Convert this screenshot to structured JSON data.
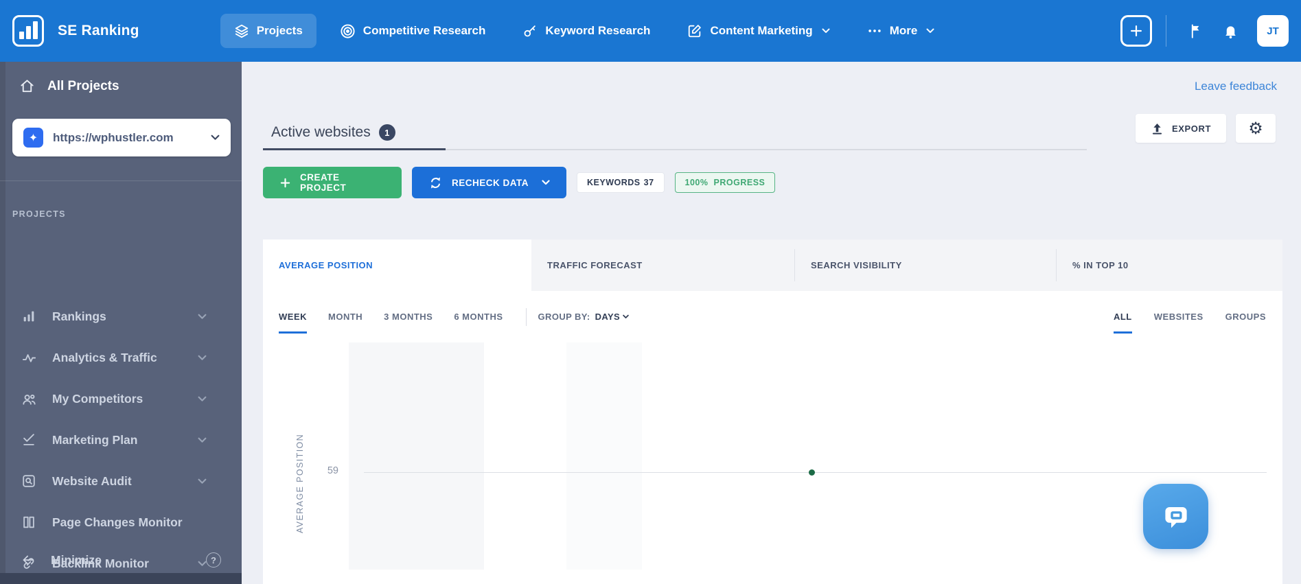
{
  "nav": {
    "brand": "SE Ranking",
    "items": [
      {
        "label": "Projects",
        "icon": "layers",
        "active": true
      },
      {
        "label": "Competitive Research",
        "icon": "target",
        "active": false
      },
      {
        "label": "Keyword Research",
        "icon": "key",
        "active": false
      },
      {
        "label": "Content Marketing",
        "icon": "edit-square",
        "has_dropdown": true,
        "active": false
      },
      {
        "label": "More",
        "icon": "ellipsis",
        "has_dropdown": true,
        "active": false
      }
    ],
    "user_initials": "JT"
  },
  "sidebar": {
    "all_projects_label": "All Projects",
    "project_url": "https://wphustler.com",
    "section_label": "PROJECTS",
    "items": [
      {
        "label": "Rankings",
        "icon": "bar-chart",
        "has_dropdown": true
      },
      {
        "label": "Analytics & Traffic",
        "icon": "pulse",
        "has_dropdown": true
      },
      {
        "label": "My Competitors",
        "icon": "users",
        "has_dropdown": true
      },
      {
        "label": "Marketing Plan",
        "icon": "check-list",
        "has_dropdown": true
      },
      {
        "label": "Website Audit",
        "icon": "search-square",
        "has_dropdown": true
      },
      {
        "label": "Page Changes Monitor",
        "icon": "pages",
        "has_dropdown": false
      },
      {
        "label": "Backlink Monitor",
        "icon": "link",
        "has_dropdown": true
      }
    ],
    "minimize_label": "Minimize"
  },
  "header": {
    "leave_feedback": "Leave feedback",
    "active_tab": "Active websites",
    "active_tab_count": "1",
    "export_label": "EXPORT"
  },
  "toolbar": {
    "create_project": "CREATE PROJECT",
    "recheck_data": "RECHECK DATA",
    "keywords_label": "KEYWORDS",
    "keywords_value": "37",
    "progress_value": "100%",
    "progress_label": "PROGRESS"
  },
  "metric_tabs": [
    {
      "label": "AVERAGE POSITION",
      "active": true
    },
    {
      "label": "TRAFFIC FORECAST",
      "active": false
    },
    {
      "label": "SEARCH VISIBILITY",
      "active": false
    },
    {
      "label": "% IN TOP 10",
      "active": false
    }
  ],
  "controls": {
    "ranges": [
      {
        "label": "WEEK",
        "active": true
      },
      {
        "label": "MONTH",
        "active": false
      },
      {
        "label": "3 MONTHS",
        "active": false
      },
      {
        "label": "6 MONTHS",
        "active": false
      }
    ],
    "group_by_label": "GROUP BY:",
    "group_by_value": "DAYS",
    "scopes": [
      {
        "label": "ALL",
        "active": true
      },
      {
        "label": "WEBSITES",
        "active": false
      },
      {
        "label": "GROUPS",
        "active": false
      }
    ]
  },
  "chart_data": {
    "type": "line",
    "ylabel": "AVERAGE POSITION",
    "y_ticks": [
      59
    ],
    "series": [
      {
        "name": "https://wphustler.com",
        "values": [
          59
        ]
      }
    ],
    "point_color": "#1c6b46",
    "gridlines": "single horizontal line at y=59",
    "legend_position": "none"
  },
  "colors": {
    "nav_blue": "#1a76d2",
    "sidebar_slate": "#58627a",
    "accent_blue": "#1e6fd9",
    "button_green": "#3bb273",
    "progress_green": "#3fa873",
    "page_bg": "#edeff5"
  }
}
